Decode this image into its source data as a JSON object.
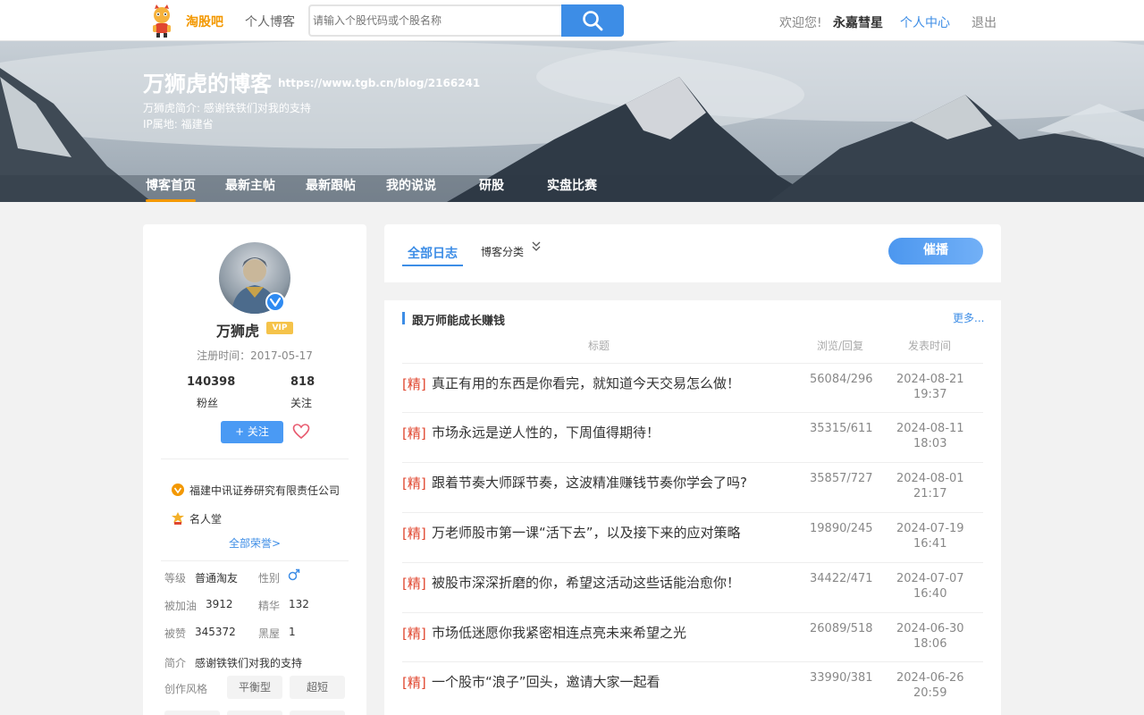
{
  "header": {
    "brand": "淘股吧",
    "nav_blog": "个人博客",
    "search_placeholder": "请输入个股代码或个股名称",
    "welcome": "欢迎您!",
    "username": "永嘉彗星",
    "personal_center": "个人中心",
    "logout": "退出"
  },
  "banner": {
    "title": "万狮虎的博客",
    "url": "https://www.tgb.cn/blog/2166241",
    "intro": "万狮虎简介: 感谢铁铁们对我的支持",
    "ip": "IP属地: 福建省",
    "tabs": [
      "博客首页",
      "最新主帖",
      "最新跟帖",
      "我的说说",
      "研股",
      "实盘比赛"
    ]
  },
  "profile": {
    "name": "万狮虎",
    "vip": "VIP",
    "reg_time": "注册时间：2017-05-17",
    "fans_count": "140398",
    "fans_label": "粉丝",
    "follow_count": "818",
    "follow_label": "关注",
    "follow_button": "+ 关注",
    "honors": [
      "福建中讯证券研究有限责任公司",
      "名人堂"
    ],
    "all_honors": "全部荣誉>",
    "details": {
      "level_label": "等级",
      "level": "普通淘友",
      "gender_label": "性别",
      "cheer_label": "被加油",
      "cheer": "3912",
      "essence_label": "精华",
      "essence": "132",
      "likes_label": "被赞",
      "likes": "345372",
      "blackhouse_label": "黑屋",
      "blackhouse": "1",
      "bio_label": "简介",
      "bio": "感谢铁铁们对我的支持",
      "style_label": "创作风格",
      "styles": [
        "平衡型",
        "超短"
      ]
    }
  },
  "main": {
    "tab_all": "全部日志",
    "tab_category": "博客分类",
    "broadcast": "催播",
    "section_title": "跟万师能成长赚钱",
    "more": "更多...",
    "columns": {
      "title": "标题",
      "views": "浏览/回复",
      "time": "发表时间"
    },
    "posts": [
      {
        "tag": "[精]",
        "title": "真正有用的东西是你看完，就知道今天交易怎么做！",
        "views": "56084/296",
        "date": "2024-08-21",
        "time": "19:37"
      },
      {
        "tag": "[精]",
        "title": "市场永远是逆人性的，下周值得期待！",
        "views": "35315/611",
        "date": "2024-08-11",
        "time": "18:03"
      },
      {
        "tag": "[精]",
        "title": "跟着节奏大师踩节奏，这波精准赚钱节奏你学会了吗?",
        "views": "35857/727",
        "date": "2024-08-01",
        "time": "21:17"
      },
      {
        "tag": "[精]",
        "title": "万老师股市第一课“活下去”，以及接下来的应对策略",
        "views": "19890/245",
        "date": "2024-07-19",
        "time": "16:41"
      },
      {
        "tag": "[精]",
        "title": "被股市深深折磨的你，希望这活动这些话能治愈你！",
        "views": "34422/471",
        "date": "2024-07-07",
        "time": "16:40"
      },
      {
        "tag": "[精]",
        "title": "市场低迷愿你我紧密相连点亮未来希望之光",
        "views": "26089/518",
        "date": "2024-06-30",
        "time": "18:06"
      },
      {
        "tag": "[精]",
        "title": "一个股市“浪子”回头，邀请大家一起看",
        "views": "33990/381",
        "date": "2024-06-26",
        "time": "20:59"
      }
    ]
  }
}
